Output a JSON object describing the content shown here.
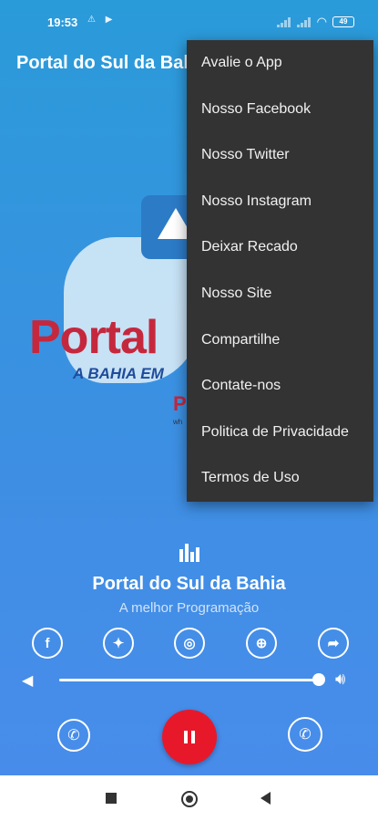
{
  "status_bar": {
    "time": "19:53",
    "left_icons": "⚠ ▶",
    "battery": "49"
  },
  "app": {
    "title": "Portal do Sul da Bahia"
  },
  "logo": {
    "main": "Portal",
    "tagline": "A BAHIA EM",
    "letter": "P",
    "url": "wh"
  },
  "player": {
    "station_name": "Portal do Sul da Bahia",
    "station_subtitle": "A melhor Programação",
    "volume_fraction": 0.97,
    "state": "playing"
  },
  "social_icons": [
    "facebook-icon",
    "twitter-icon",
    "instagram-icon",
    "globe-icon",
    "share-icon"
  ],
  "menu": {
    "items": [
      "Avalie o App",
      "Nosso Facebook",
      "Nosso Twitter",
      "Nosso Instagram",
      "Deixar Recado",
      "Nosso Site",
      "Compartilhe",
      "Contate-nos",
      "Politica de Privacidade",
      "Termos de Uso"
    ]
  },
  "colors": {
    "accent": "#e8182b",
    "menu_bg": "#333333",
    "gradient_top": "#2a9bd9",
    "gradient_bottom": "#4a8cec"
  }
}
